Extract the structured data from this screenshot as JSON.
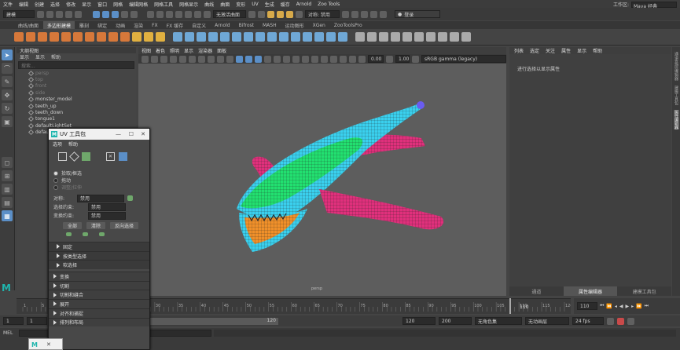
{
  "menubar": [
    "文件",
    "编辑",
    "创建",
    "选择",
    "修改",
    "显示",
    "窗口",
    "网格",
    "编辑网格",
    "网格工具",
    "网格显示",
    "曲线",
    "曲面",
    "变形",
    "UV",
    "生成",
    "缓存",
    "Arnold",
    "Zoo Tools"
  ],
  "workspace": {
    "label": "工作区:",
    "value": "Maya 经典"
  },
  "status": {
    "mode": "建模",
    "snap_label": "无激活曲面",
    "symmetry": "对称: 禁用",
    "login": "登录"
  },
  "shelf_tabs": [
    "曲线/曲面",
    "多边形建模",
    "雕刻",
    "绑定",
    "动画",
    "渲染",
    "FX",
    "FX 缓存",
    "自定义",
    "Arnold",
    "Bifrost",
    "MASH",
    "运动图形",
    "XGen",
    "ZooToolsPro"
  ],
  "shelf_active": 1,
  "outliner": {
    "title": "大纲视图",
    "menu": [
      "显示",
      "显示",
      "帮助"
    ],
    "search_placeholder": "搜索...",
    "items": [
      {
        "name": "persp",
        "dim": true
      },
      {
        "name": "top",
        "dim": true
      },
      {
        "name": "front",
        "dim": true
      },
      {
        "name": "side",
        "dim": true
      },
      {
        "name": "monster_model",
        "dim": false
      },
      {
        "name": "teeth_up",
        "dim": false
      },
      {
        "name": "teeth_down",
        "dim": false
      },
      {
        "name": "tongue1",
        "dim": false
      },
      {
        "name": "defaultLightSet",
        "dim": false
      },
      {
        "name": "defaultObjectSet",
        "dim": false
      }
    ]
  },
  "viewport": {
    "menu": [
      "视图",
      "着色",
      "照明",
      "显示",
      "渲染器",
      "面板"
    ],
    "exposure": "0.00",
    "gamma": "1.00",
    "colorspace": "sRGB gamma (legacy)",
    "camera_label": "persp"
  },
  "right_panel": {
    "menu": [
      "列表",
      "选定",
      "关注",
      "属性",
      "显示",
      "帮助"
    ],
    "hint": "进行选择以显示属性",
    "tabs": [
      "通道",
      "属性编辑器",
      "建模工具包"
    ],
    "active_tab": 1,
    "side_tabs": [
      "通道盒/层编辑器",
      "建模工具包",
      "属性编辑器"
    ]
  },
  "uv_toolkit": {
    "title": "UV 工具包",
    "menu": [
      "选项",
      "帮助"
    ],
    "radios": [
      {
        "label": "拾取/框选",
        "selected": true,
        "dim": false
      },
      {
        "label": "拖动",
        "selected": false,
        "dim": false
      },
      {
        "label": "调整/拉伸",
        "selected": false,
        "dim": true
      }
    ],
    "symmetry_label": "对称:",
    "symmetry_value": "禁用",
    "select_mode_label": "选择约束:",
    "select_mode_value": "禁用",
    "transform_label": "变换约束:",
    "transform_value": "禁用",
    "buttons": [
      "全部",
      "清除",
      "反向选择"
    ],
    "subsections": [
      "固定",
      "按类型选择",
      "软选择"
    ],
    "sections": [
      "变换",
      "切割",
      "切割和缝合",
      "展开",
      "对齐和捕捉",
      "排列和布局"
    ]
  },
  "timeline": {
    "ticks": [
      1,
      5,
      10,
      15,
      20,
      25,
      30,
      35,
      40,
      45,
      50,
      55,
      60,
      65,
      70,
      75,
      80,
      85,
      90,
      95,
      100,
      105,
      110,
      115,
      120
    ],
    "current_frame": "110",
    "current_field": "110"
  },
  "range": {
    "start": "1",
    "start_inner": "1",
    "end_inner": "120",
    "end": "120",
    "end_max": "200",
    "char_set": "无角色集",
    "anim_layer": "无动画层",
    "fps": "24 fps"
  },
  "cmdline": {
    "label": "MEL"
  },
  "mini_window": {
    "label": "M"
  }
}
